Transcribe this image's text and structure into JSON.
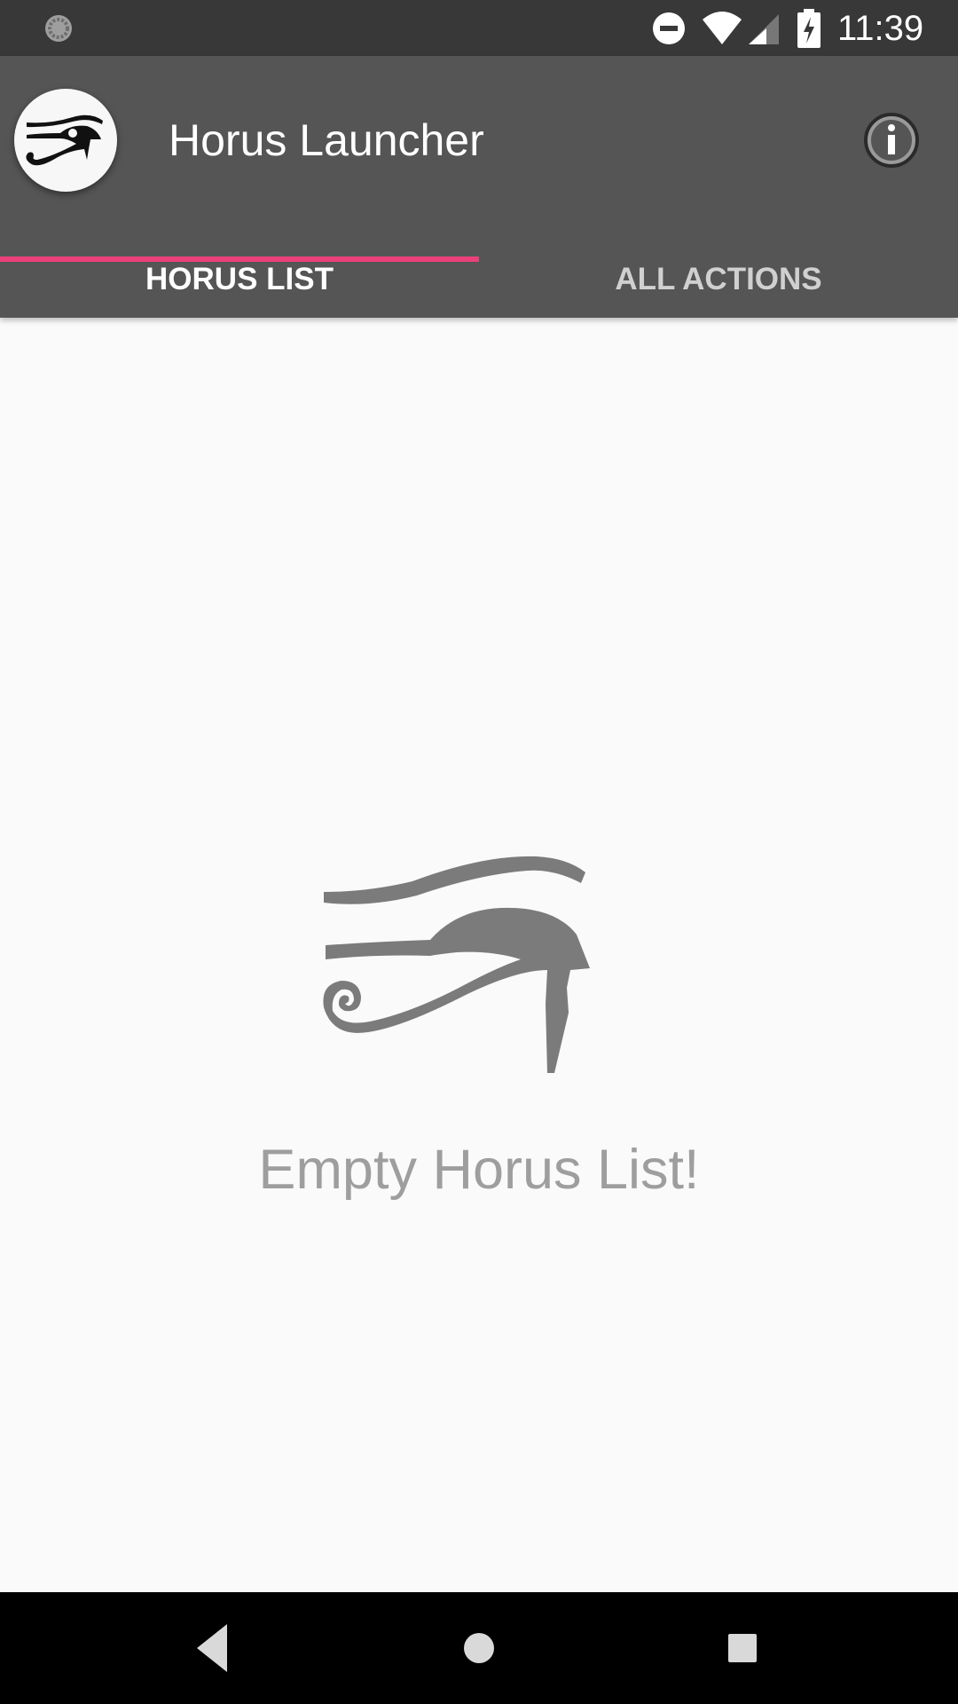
{
  "status_bar": {
    "time": "11:39",
    "icons": [
      "sync-icon",
      "do-not-disturb-icon",
      "wifi-icon",
      "cell-signal-icon",
      "battery-charging-icon"
    ]
  },
  "app_bar": {
    "title": "Horus Launcher",
    "logo_icon": "eye-of-horus-icon",
    "info_icon": "info-icon",
    "background": "#555555"
  },
  "tabs": [
    {
      "label": "HORUS LIST",
      "selected": true
    },
    {
      "label": "ALL ACTIONS",
      "selected": false
    }
  ],
  "accent_color": "#ec407a",
  "empty_state": {
    "icon": "eye-of-horus-icon",
    "message": "Empty Horus List!"
  },
  "nav_bar": {
    "buttons": [
      "back-icon",
      "home-icon",
      "recents-icon"
    ]
  }
}
